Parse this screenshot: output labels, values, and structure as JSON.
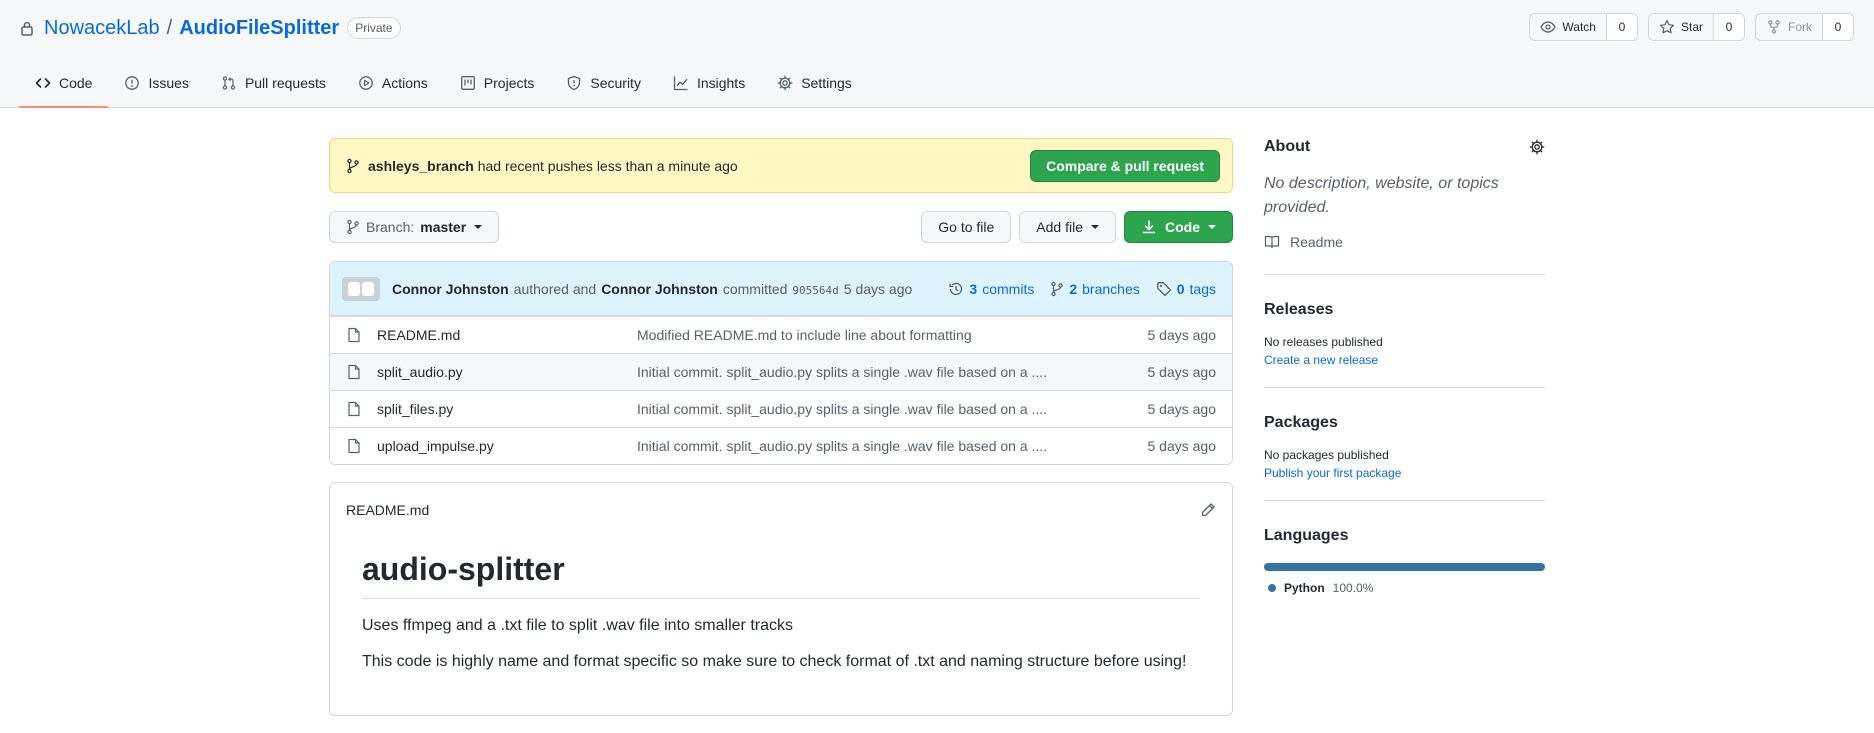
{
  "repo": {
    "owner": "NowacekLab",
    "separator": "/",
    "name": "AudioFileSplitter",
    "visibility": "Private"
  },
  "actions": {
    "watch": {
      "label": "Watch",
      "count": "0"
    },
    "star": {
      "label": "Star",
      "count": "0"
    },
    "fork": {
      "label": "Fork",
      "count": "0"
    }
  },
  "tabs": [
    {
      "label": "Code",
      "icon": "code-icon"
    },
    {
      "label": "Issues",
      "icon": "issue-icon"
    },
    {
      "label": "Pull requests",
      "icon": "pull-request-icon"
    },
    {
      "label": "Actions",
      "icon": "play-icon"
    },
    {
      "label": "Projects",
      "icon": "project-icon"
    },
    {
      "label": "Security",
      "icon": "shield-icon"
    },
    {
      "label": "Insights",
      "icon": "graph-icon"
    },
    {
      "label": "Settings",
      "icon": "gear-icon"
    }
  ],
  "flash": {
    "branch": "ashleys_branch",
    "message": "had recent pushes less than a minute ago",
    "button": "Compare & pull request"
  },
  "file_nav": {
    "branch_label": "Branch:",
    "branch_value": "master",
    "go_to_file": "Go to file",
    "add_file": "Add file",
    "code": "Code"
  },
  "commit": {
    "author": "Connor Johnston",
    "authored": "authored and",
    "committer": "Connor Johnston",
    "committed": "committed",
    "sha": "905564d",
    "age": "5 days ago",
    "commits_count": "3",
    "commits_label": "commits",
    "branches_count": "2",
    "branches_label": "branches",
    "tags_count": "0",
    "tags_label": "tags"
  },
  "files": [
    {
      "name": "README.md",
      "message": "Modified README.md to include line about formatting",
      "age": "5 days ago"
    },
    {
      "name": "split_audio.py",
      "message": "Initial commit. split_audio.py splits a single .wav file based on a ....",
      "age": "5 days ago"
    },
    {
      "name": "split_files.py",
      "message": "Initial commit. split_audio.py splits a single .wav file based on a ....",
      "age": "5 days ago"
    },
    {
      "name": "upload_impulse.py",
      "message": "Initial commit. split_audio.py splits a single .wav file based on a ....",
      "age": "5 days ago"
    }
  ],
  "readme": {
    "filename": "README.md",
    "heading": "audio-splitter",
    "paragraphs": [
      "Uses ffmpeg and a .txt file to split .wav file into smaller tracks",
      "This code is highly name and format specific so make sure to check format of .txt and naming structure before using!"
    ]
  },
  "sidebar": {
    "about": {
      "title": "About",
      "description": "No description, website, or topics provided.",
      "readme_link": "Readme"
    },
    "releases": {
      "title": "Releases",
      "empty": "No releases published",
      "link": "Create a new release"
    },
    "packages": {
      "title": "Packages",
      "empty": "No packages published",
      "link": "Publish your first package"
    },
    "languages": {
      "title": "Languages",
      "items": [
        {
          "name": "Python",
          "percent": "100.0%",
          "color": "#3572A5"
        }
      ]
    }
  },
  "colors": {
    "link": "#0969da",
    "primary_button": "#2da44e",
    "flash_background": "#fff8c5",
    "commit_background": "#ddf4ff",
    "selected_tab_underline": "#fd8c73"
  }
}
